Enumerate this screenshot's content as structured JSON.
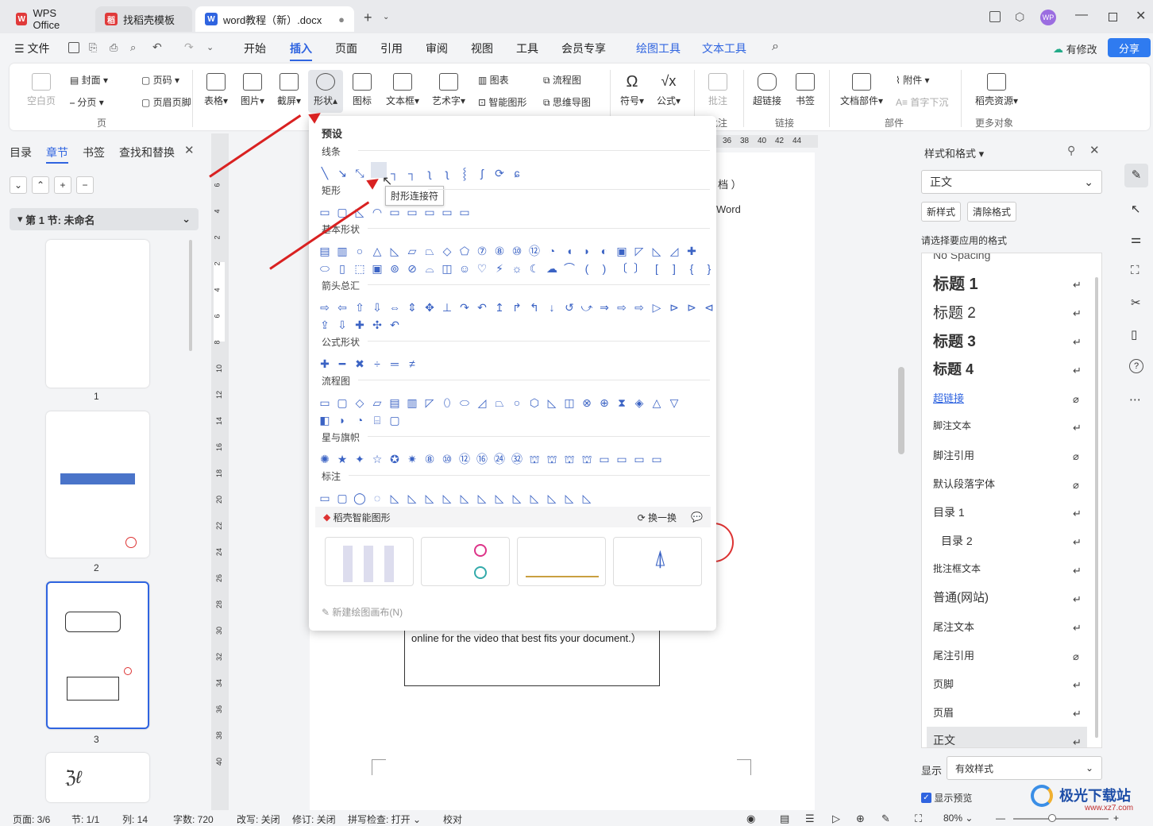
{
  "tabs": {
    "wps": "WPS Office",
    "template": "找稻壳模板",
    "doc": "word教程（新）.docx"
  },
  "menu": {
    "file": "文件",
    "items": [
      "开始",
      "插入",
      "页面",
      "引用",
      "审阅",
      "视图",
      "工具",
      "会员专享",
      "绘图工具",
      "文本工具"
    ],
    "modify": "有修改",
    "share": "分享"
  },
  "ribbon": {
    "blank_page": "空白页",
    "cover": "封面",
    "page_break": "分页",
    "page_num": "页码",
    "header_footer": "页眉页脚",
    "group_page": "页",
    "table": "表格",
    "picture": "图片",
    "screenshot": "截屏",
    "shape": "形状",
    "icon": "图标",
    "textbox": "文本框",
    "wordart": "艺术字",
    "chart": "图表",
    "smartart": "智能图形",
    "flowchart": "流程图",
    "mindmap": "思维导图",
    "symbol": "符号",
    "formula": "公式",
    "comment": "批注",
    "group_comment": "批注",
    "hyperlink": "超链接",
    "bookmark": "书签",
    "group_link": "链接",
    "doc_parts": "文档部件",
    "attachment": "附件",
    "dropcap": "首字下沉",
    "group_parts": "部件",
    "daoke": "稻壳资源",
    "group_more": "更多对象"
  },
  "left": {
    "tabs": [
      "目录",
      "章节",
      "书签",
      "查找和替换"
    ],
    "section": "第 1 节: 未命名",
    "pages": [
      "1",
      "2",
      "3"
    ]
  },
  "ruler": {
    "h": [
      "36",
      "38",
      "40",
      "42",
      "44"
    ],
    "v": [
      "6",
      "4",
      "2",
      "2",
      "4",
      "6",
      "8",
      "10",
      "12",
      "14",
      "16",
      "18",
      "20",
      "22",
      "24",
      "26",
      "28",
      "30",
      "32",
      "34",
      "36",
      "38",
      "40"
    ]
  },
  "doc": {
    "text1": "档 ）",
    "text2": "Word",
    "text3": "online for the video that best fits your document.）"
  },
  "dropdown": {
    "preset": "预设",
    "lines": "线条",
    "rect": "矩形",
    "basic": "基本形状",
    "arrows": "箭头总汇",
    "formula": "公式形状",
    "flow": "流程图",
    "stars": "星与旗帜",
    "callout": "标注",
    "tooltip": "肘形连接符",
    "smart": "稻壳智能图形",
    "refresh": "换一换",
    "new_canvas": "新建绘图画布(N)"
  },
  "right": {
    "title": "样式和格式",
    "current": "正文",
    "new_style": "新样式",
    "clear": "清除格式",
    "choose": "请选择要应用的格式",
    "styles": [
      "No Spacing",
      "标题 1",
      "标题 2",
      "标题 3",
      "标题 4",
      "超链接",
      "脚注文本",
      "脚注引用",
      "默认段落字体",
      "目录 1",
      "目录 2",
      "批注框文本",
      "普通(网站)",
      "尾注文本",
      "尾注引用",
      "页脚",
      "页眉",
      "正文"
    ],
    "show": "显示",
    "show_value": "有效样式",
    "preview": "显示预览"
  },
  "status": {
    "page": "页面: 3/6",
    "section": "节: 1/1",
    "col": "列: 14",
    "words": "字数: 720",
    "revise": "改写: 关闭",
    "track": "修订: 关闭",
    "spell": "拼写检查: 打开",
    "proof": "校对",
    "zoom": "80%"
  },
  "watermark": "极光下载站",
  "watermark_url": "www.xz7.com"
}
